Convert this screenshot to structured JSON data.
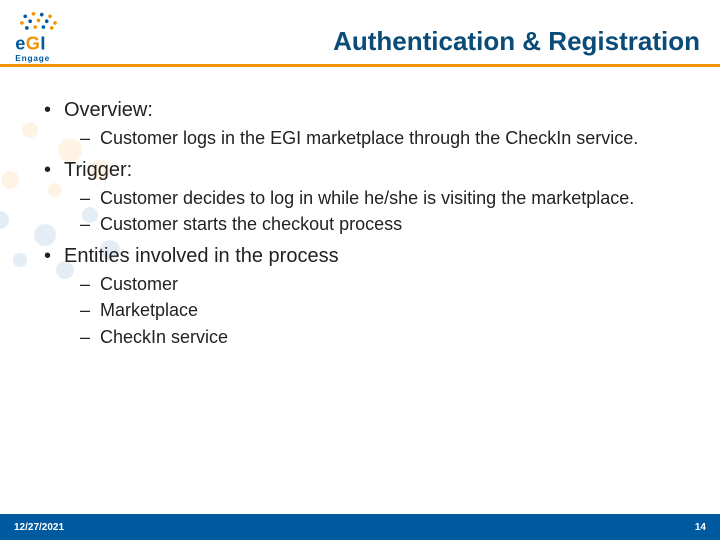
{
  "logo": {
    "brand_e": "e",
    "brand_g": "G",
    "brand_i": "I",
    "subtitle": "Engage"
  },
  "title": "Authentication & Registration",
  "bullets": {
    "b1": "Overview:",
    "b1_1": "Customer logs in the EGI marketplace through the CheckIn service.",
    "b2": "Trigger:",
    "b2_1": "Customer decides to log in while he/she is visiting the marketplace.",
    "b2_2": "Customer starts the checkout process",
    "b3": "Entities involved in the process",
    "b3_1": "Customer",
    "b3_2": "Marketplace",
    "b3_3": "CheckIn service"
  },
  "footer": {
    "date": "12/27/2021",
    "page": "14"
  }
}
